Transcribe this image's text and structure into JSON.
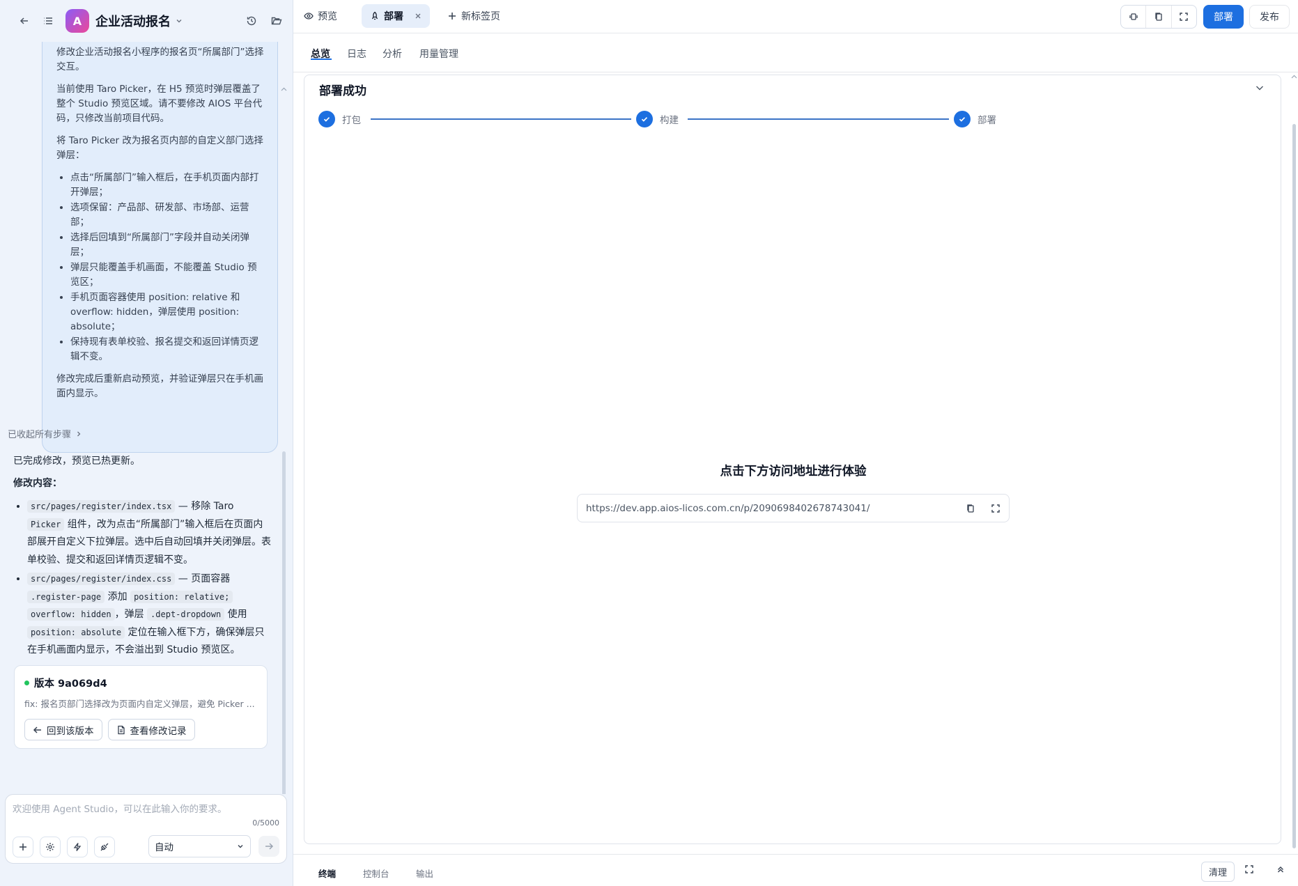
{
  "left": {
    "app_title": "企业活动报名",
    "app_logo_letter": "A",
    "request": {
      "p1": "修改企业活动报名小程序的报名页“所属部门”选择交互。",
      "p2": "当前使用 Taro Picker，在 H5 预览时弹层覆盖了整个 Studio 预览区域。请不要修改 AIOS 平台代码，只修改当前项目代码。",
      "p3": "将 Taro Picker 改为报名页内部的自定义部门选择弹层：",
      "items": [
        "点击“所属部门”输入框后，在手机页面内部打开弹层；",
        "选项保留：产品部、研发部、市场部、运营部；",
        "选择后回填到“所属部门”字段并自动关闭弹层；",
        "弹层只能覆盖手机画面，不能覆盖 Studio 预览区；",
        "手机页面容器使用 position: relative 和 overflow: hidden，弹层使用 position: absolute；",
        "保持现有表单校验、报名提交和返回详情页逻辑不变。"
      ],
      "p4": "修改完成后重新启动预览，并验证弹层只在手机画面内显示。"
    },
    "collapsed_steps": "已收起所有步骤",
    "reply": {
      "intro": "已完成修改，预览已热更新。",
      "label": "修改内容：",
      "item1": {
        "file": "src/pages/register/index.tsx",
        "t1": " — 移除 Taro ",
        "code2": "Picker",
        "t2": " 组件，改为点击“所属部门”输入框后在页面内部展开自定义下拉弹层。选中后自动回填并关闭弹层。表单校验、提交和返回详情页逻辑不变。"
      },
      "item2": {
        "file": "src/pages/register/index.css",
        "t1": " — 页面容器 ",
        "code2": ".register-page",
        "t2": " 添加 ",
        "code3": "position: relative;",
        "t3": " ",
        "code4": "overflow: hidden",
        "t4": "，弹层 ",
        "code5": ".dept-dropdown",
        "t5": " 使用 ",
        "code6": "position: absolute",
        "t6": " 定位在输入框下方，确保弹层只在手机画面内显示，不会溢出到 Studio 预览区。"
      }
    },
    "version": {
      "title": "版本 9a069d4",
      "desc": "fix: 报名页部门选择改为页面内自定义弹层，避免 Picker ...",
      "revert_label": "回到该版本",
      "history_label": "查看修改记录"
    },
    "input": {
      "placeholder": "欢迎使用 Agent Studio，可以在此输入你的要求。",
      "counter": "0/5000",
      "mode": "自动"
    }
  },
  "topbar": {
    "tabs": {
      "preview": "预览",
      "deploy": "部署",
      "new_tab": "新标签页"
    },
    "deploy_btn": "部署",
    "publish_btn": "发布"
  },
  "subtabs": [
    "总览",
    "日志",
    "分析",
    "用量管理"
  ],
  "panel": {
    "title": "部署成功",
    "steps": [
      "打包",
      "构建",
      "部署"
    ],
    "experience_title": "点击下方访问地址进行体验",
    "url": "https://dev.app.aios-licos.com.cn/p/2090698402678743041/"
  },
  "bottom": {
    "tabs": [
      "终端",
      "控制台",
      "输出"
    ],
    "clear_btn": "清理"
  }
}
